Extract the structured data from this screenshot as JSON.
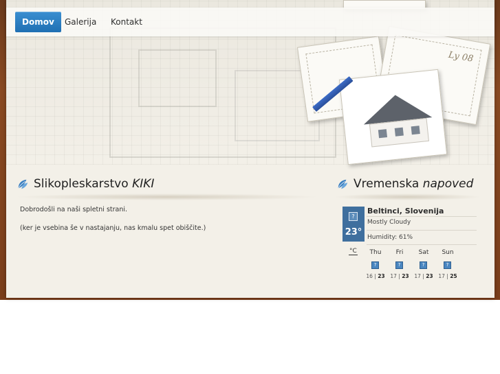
{
  "nav": {
    "items": [
      {
        "label": "Domov",
        "active": true
      },
      {
        "label": "Galerija",
        "active": false
      },
      {
        "label": "Kontakt",
        "active": false
      }
    ]
  },
  "hero": {
    "sketch_label": "Ly 08"
  },
  "main": {
    "title_prefix": "Slikopleskarstvo",
    "title_emphasis": "KIKI",
    "paragraphs": [
      "Dobrodošli na naši spletni strani.",
      "(ker je vsebina še v nastajanju, nas kmalu spet obiščite.)"
    ]
  },
  "weather": {
    "title_prefix": "Vremenska",
    "title_emphasis": "napoved",
    "location": "Beltinci, Slovenija",
    "current_temp": "23°",
    "condition": "Mostly Cloudy",
    "humidity": "Humidity: 61%",
    "unit": "°C",
    "icon_placeholder": "?",
    "forecast": [
      {
        "day": "Thu",
        "low": "16",
        "high": "23"
      },
      {
        "day": "Fri",
        "low": "17",
        "high": "23"
      },
      {
        "day": "Sat",
        "low": "17",
        "high": "23"
      },
      {
        "day": "Sun",
        "low": "17",
        "high": "25"
      }
    ]
  },
  "colors": {
    "accent": "#1f6fb3",
    "weather_box": "#3f6f9e",
    "frame": "#7a3e1b"
  },
  "icons": {
    "section_icon": "leaf-icon",
    "weather_icon": "unknown-weather-icon"
  }
}
